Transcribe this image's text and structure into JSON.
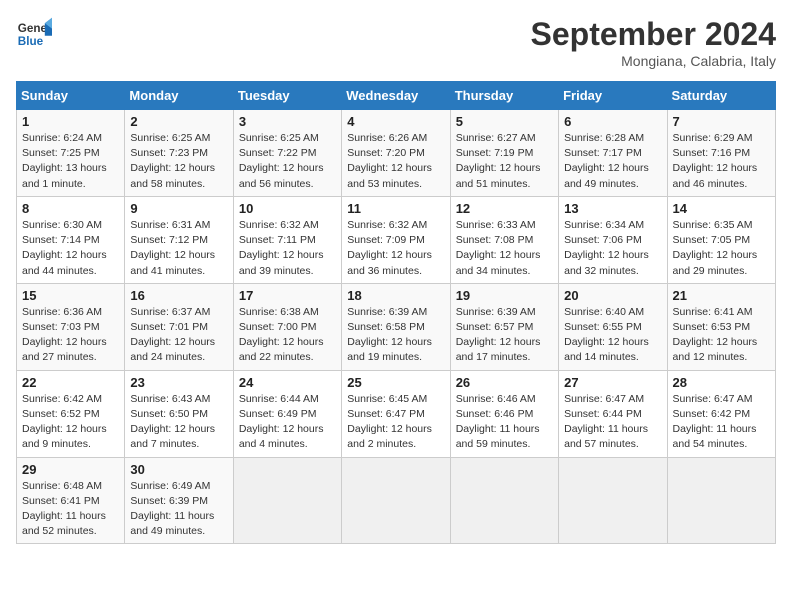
{
  "logo": {
    "line1": "General",
    "line2": "Blue"
  },
  "title": "September 2024",
  "subtitle": "Mongiana, Calabria, Italy",
  "header_days": [
    "Sunday",
    "Monday",
    "Tuesday",
    "Wednesday",
    "Thursday",
    "Friday",
    "Saturday"
  ],
  "weeks": [
    [
      {
        "day": "1",
        "info": "Sunrise: 6:24 AM\nSunset: 7:25 PM\nDaylight: 13 hours\nand 1 minute."
      },
      {
        "day": "2",
        "info": "Sunrise: 6:25 AM\nSunset: 7:23 PM\nDaylight: 12 hours\nand 58 minutes."
      },
      {
        "day": "3",
        "info": "Sunrise: 6:25 AM\nSunset: 7:22 PM\nDaylight: 12 hours\nand 56 minutes."
      },
      {
        "day": "4",
        "info": "Sunrise: 6:26 AM\nSunset: 7:20 PM\nDaylight: 12 hours\nand 53 minutes."
      },
      {
        "day": "5",
        "info": "Sunrise: 6:27 AM\nSunset: 7:19 PM\nDaylight: 12 hours\nand 51 minutes."
      },
      {
        "day": "6",
        "info": "Sunrise: 6:28 AM\nSunset: 7:17 PM\nDaylight: 12 hours\nand 49 minutes."
      },
      {
        "day": "7",
        "info": "Sunrise: 6:29 AM\nSunset: 7:16 PM\nDaylight: 12 hours\nand 46 minutes."
      }
    ],
    [
      {
        "day": "8",
        "info": "Sunrise: 6:30 AM\nSunset: 7:14 PM\nDaylight: 12 hours\nand 44 minutes."
      },
      {
        "day": "9",
        "info": "Sunrise: 6:31 AM\nSunset: 7:12 PM\nDaylight: 12 hours\nand 41 minutes."
      },
      {
        "day": "10",
        "info": "Sunrise: 6:32 AM\nSunset: 7:11 PM\nDaylight: 12 hours\nand 39 minutes."
      },
      {
        "day": "11",
        "info": "Sunrise: 6:32 AM\nSunset: 7:09 PM\nDaylight: 12 hours\nand 36 minutes."
      },
      {
        "day": "12",
        "info": "Sunrise: 6:33 AM\nSunset: 7:08 PM\nDaylight: 12 hours\nand 34 minutes."
      },
      {
        "day": "13",
        "info": "Sunrise: 6:34 AM\nSunset: 7:06 PM\nDaylight: 12 hours\nand 32 minutes."
      },
      {
        "day": "14",
        "info": "Sunrise: 6:35 AM\nSunset: 7:05 PM\nDaylight: 12 hours\nand 29 minutes."
      }
    ],
    [
      {
        "day": "15",
        "info": "Sunrise: 6:36 AM\nSunset: 7:03 PM\nDaylight: 12 hours\nand 27 minutes."
      },
      {
        "day": "16",
        "info": "Sunrise: 6:37 AM\nSunset: 7:01 PM\nDaylight: 12 hours\nand 24 minutes."
      },
      {
        "day": "17",
        "info": "Sunrise: 6:38 AM\nSunset: 7:00 PM\nDaylight: 12 hours\nand 22 minutes."
      },
      {
        "day": "18",
        "info": "Sunrise: 6:39 AM\nSunset: 6:58 PM\nDaylight: 12 hours\nand 19 minutes."
      },
      {
        "day": "19",
        "info": "Sunrise: 6:39 AM\nSunset: 6:57 PM\nDaylight: 12 hours\nand 17 minutes."
      },
      {
        "day": "20",
        "info": "Sunrise: 6:40 AM\nSunset: 6:55 PM\nDaylight: 12 hours\nand 14 minutes."
      },
      {
        "day": "21",
        "info": "Sunrise: 6:41 AM\nSunset: 6:53 PM\nDaylight: 12 hours\nand 12 minutes."
      }
    ],
    [
      {
        "day": "22",
        "info": "Sunrise: 6:42 AM\nSunset: 6:52 PM\nDaylight: 12 hours\nand 9 minutes."
      },
      {
        "day": "23",
        "info": "Sunrise: 6:43 AM\nSunset: 6:50 PM\nDaylight: 12 hours\nand 7 minutes."
      },
      {
        "day": "24",
        "info": "Sunrise: 6:44 AM\nSunset: 6:49 PM\nDaylight: 12 hours\nand 4 minutes."
      },
      {
        "day": "25",
        "info": "Sunrise: 6:45 AM\nSunset: 6:47 PM\nDaylight: 12 hours\nand 2 minutes."
      },
      {
        "day": "26",
        "info": "Sunrise: 6:46 AM\nSunset: 6:46 PM\nDaylight: 11 hours\nand 59 minutes."
      },
      {
        "day": "27",
        "info": "Sunrise: 6:47 AM\nSunset: 6:44 PM\nDaylight: 11 hours\nand 57 minutes."
      },
      {
        "day": "28",
        "info": "Sunrise: 6:47 AM\nSunset: 6:42 PM\nDaylight: 11 hours\nand 54 minutes."
      }
    ],
    [
      {
        "day": "29",
        "info": "Sunrise: 6:48 AM\nSunset: 6:41 PM\nDaylight: 11 hours\nand 52 minutes."
      },
      {
        "day": "30",
        "info": "Sunrise: 6:49 AM\nSunset: 6:39 PM\nDaylight: 11 hours\nand 49 minutes."
      },
      {
        "day": "",
        "info": ""
      },
      {
        "day": "",
        "info": ""
      },
      {
        "day": "",
        "info": ""
      },
      {
        "day": "",
        "info": ""
      },
      {
        "day": "",
        "info": ""
      }
    ]
  ]
}
